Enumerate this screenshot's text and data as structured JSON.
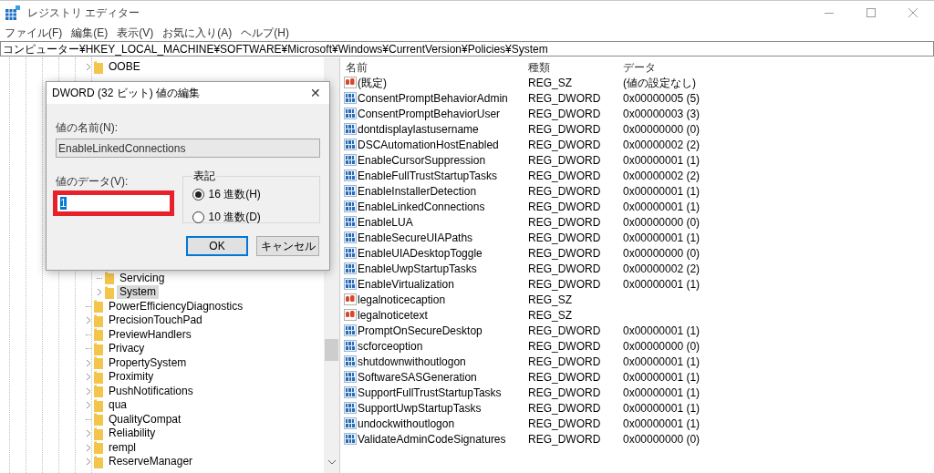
{
  "window": {
    "title": "レジストリ エディター"
  },
  "menu": [
    "ファイル(F)",
    "編集(E)",
    "表示(V)",
    "お気に入り(A)",
    "ヘルプ(H)"
  ],
  "address": "コンピューター¥HKEY_LOCAL_MACHINE¥SOFTWARE¥Microsoft¥Windows¥CurrentVersion¥Policies¥System",
  "tree": {
    "items_top": [
      {
        "label": "OOBE",
        "has_children": true,
        "selected": false
      }
    ],
    "policies_children": [
      {
        "label": "Servicing",
        "has_children": false,
        "selected": false
      },
      {
        "label": "System",
        "has_children": true,
        "selected": true
      }
    ],
    "items_bottom": [
      {
        "label": "PowerEfficiencyDiagnostics",
        "has_children": false,
        "selected": false
      },
      {
        "label": "PrecisionTouchPad",
        "has_children": true,
        "selected": false
      },
      {
        "label": "PreviewHandlers",
        "has_children": false,
        "selected": false
      },
      {
        "label": "Privacy",
        "has_children": false,
        "selected": false
      },
      {
        "label": "PropertySystem",
        "has_children": true,
        "selected": false
      },
      {
        "label": "Proximity",
        "has_children": true,
        "selected": false
      },
      {
        "label": "PushNotifications",
        "has_children": true,
        "selected": false
      },
      {
        "label": "qua",
        "has_children": true,
        "selected": false
      },
      {
        "label": "QualityCompat",
        "has_children": false,
        "selected": false
      },
      {
        "label": "Reliability",
        "has_children": true,
        "selected": false
      },
      {
        "label": "rempl",
        "has_children": true,
        "selected": false
      },
      {
        "label": "ReserveManager",
        "has_children": true,
        "selected": false
      }
    ]
  },
  "table": {
    "columns": [
      "名前",
      "種類",
      "データ"
    ],
    "rows": [
      {
        "kind": "sz",
        "name": "(既定)",
        "type": "REG_SZ",
        "data": "(値の設定なし)"
      },
      {
        "kind": "dword",
        "name": "ConsentPromptBehaviorAdmin",
        "type": "REG_DWORD",
        "data": "0x00000005 (5)"
      },
      {
        "kind": "dword",
        "name": "ConsentPromptBehaviorUser",
        "type": "REG_DWORD",
        "data": "0x00000003 (3)"
      },
      {
        "kind": "dword",
        "name": "dontdisplaylastusername",
        "type": "REG_DWORD",
        "data": "0x00000000 (0)"
      },
      {
        "kind": "dword",
        "name": "DSCAutomationHostEnabled",
        "type": "REG_DWORD",
        "data": "0x00000002 (2)"
      },
      {
        "kind": "dword",
        "name": "EnableCursorSuppression",
        "type": "REG_DWORD",
        "data": "0x00000001 (1)"
      },
      {
        "kind": "dword",
        "name": "EnableFullTrustStartupTasks",
        "type": "REG_DWORD",
        "data": "0x00000002 (2)"
      },
      {
        "kind": "dword",
        "name": "EnableInstallerDetection",
        "type": "REG_DWORD",
        "data": "0x00000001 (1)"
      },
      {
        "kind": "dword",
        "name": "EnableLinkedConnections",
        "type": "REG_DWORD",
        "data": "0x00000001 (1)"
      },
      {
        "kind": "dword",
        "name": "EnableLUA",
        "type": "REG_DWORD",
        "data": "0x00000000 (0)"
      },
      {
        "kind": "dword",
        "name": "EnableSecureUIAPaths",
        "type": "REG_DWORD",
        "data": "0x00000001 (1)"
      },
      {
        "kind": "dword",
        "name": "EnableUIADesktopToggle",
        "type": "REG_DWORD",
        "data": "0x00000000 (0)"
      },
      {
        "kind": "dword",
        "name": "EnableUwpStartupTasks",
        "type": "REG_DWORD",
        "data": "0x00000002 (2)"
      },
      {
        "kind": "dword",
        "name": "EnableVirtualization",
        "type": "REG_DWORD",
        "data": "0x00000001 (1)"
      },
      {
        "kind": "sz",
        "name": "legalnoticecaption",
        "type": "REG_SZ"
      },
      {
        "kind": "sz",
        "name": "legalnoticetext",
        "type": "REG_SZ"
      },
      {
        "kind": "dword",
        "name": "PromptOnSecureDesktop",
        "type": "REG_DWORD",
        "data": "0x00000001 (1)"
      },
      {
        "kind": "dword",
        "name": "scforceoption",
        "type": "REG_DWORD",
        "data": "0x00000000 (0)"
      },
      {
        "kind": "dword",
        "name": "shutdownwithoutlogon",
        "type": "REG_DWORD",
        "data": "0x00000001 (1)"
      },
      {
        "kind": "dword",
        "name": "SoftwareSASGeneration",
        "type": "REG_DWORD",
        "data": "0x00000001 (1)"
      },
      {
        "kind": "dword",
        "name": "SupportFullTrustStartupTasks",
        "type": "REG_DWORD",
        "data": "0x00000001 (1)"
      },
      {
        "kind": "dword",
        "name": "SupportUwpStartupTasks",
        "type": "REG_DWORD",
        "data": "0x00000001 (1)"
      },
      {
        "kind": "dword",
        "name": "undockwithoutlogon",
        "type": "REG_DWORD",
        "data": "0x00000001 (1)"
      },
      {
        "kind": "dword",
        "name": "ValidateAdminCodeSignatures",
        "type": "REG_DWORD",
        "data": "0x00000000 (0)"
      }
    ]
  },
  "dialog": {
    "title": "DWORD (32 ビット) 値の編集",
    "close": "✕",
    "name_label": "値の名前(N):",
    "name_value": "EnableLinkedConnections",
    "data_label": "値のデータ(V):",
    "data_value": "1",
    "data_highlighted": true,
    "base_group": "表記",
    "bases": [
      {
        "label": "16 進数(H)",
        "selected": true
      },
      {
        "label": "10 進数(D)",
        "selected": false
      }
    ],
    "ok": "OK",
    "cancel": "キャンセル"
  }
}
